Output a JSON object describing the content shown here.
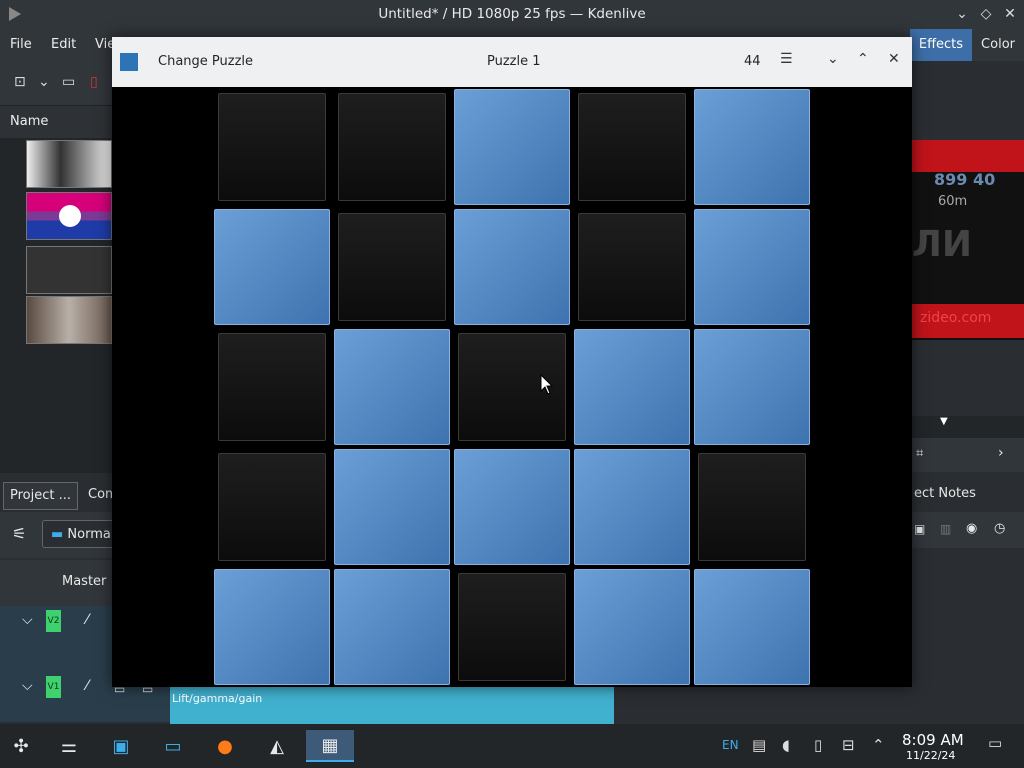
{
  "app": {
    "window_title": "Untitled* / HD 1080p 25 fps — Kdenlive",
    "menu": [
      "File",
      "Edit",
      "Vie"
    ],
    "right_tabs": [
      "Effects",
      "Color"
    ]
  },
  "left_panel": {
    "name_header": "Name",
    "tabs": [
      "Project ...",
      "Com"
    ],
    "composite_mode": "Normal",
    "master_label": "Master",
    "tracks": [
      "V2",
      "V1"
    ]
  },
  "right_panel": {
    "notes_tab": "ect Notes",
    "monitor_text": [
      "899 40",
      "60m",
      "ЛИ",
      "zideo.com"
    ]
  },
  "timeline": {
    "clip_label": "Lift/gamma/gain"
  },
  "dialog": {
    "left_title": "Change Puzzle",
    "center_title": "Puzzle 1",
    "moves": "44",
    "menu_icon": "hamburger-icon",
    "board": [
      [
        0,
        0,
        1,
        0,
        1
      ],
      [
        1,
        0,
        1,
        0,
        1
      ],
      [
        0,
        1,
        0,
        1,
        1
      ],
      [
        0,
        1,
        1,
        1,
        0
      ],
      [
        1,
        1,
        0,
        1,
        1
      ]
    ]
  },
  "taskbar": {
    "lang": "EN",
    "time": "8:09 AM",
    "date": "11/22/24"
  },
  "colors": {
    "tile_on": "#4f86c6",
    "tile_off": "#141414",
    "accent": "#3daee9",
    "track_green": "#3ed16d"
  }
}
